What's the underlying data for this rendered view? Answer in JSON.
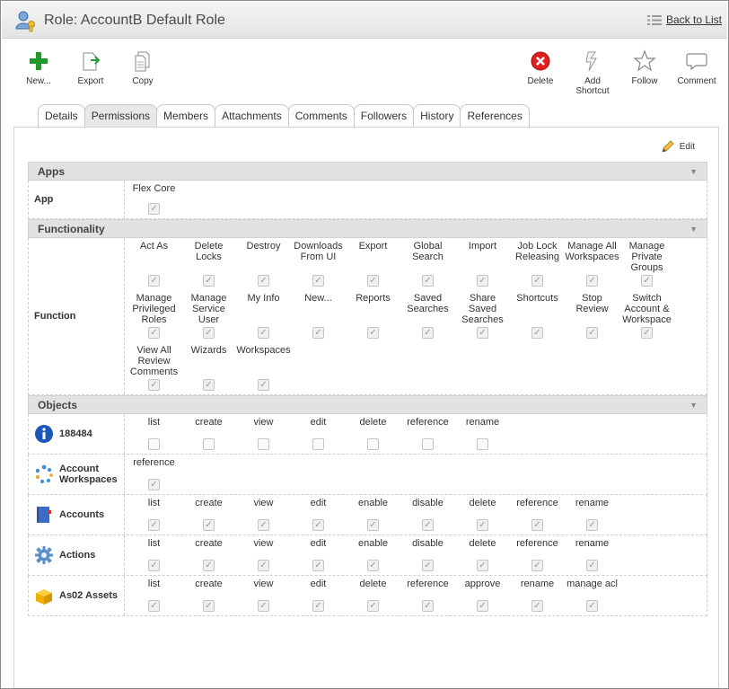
{
  "window": {
    "title": "Role: AccountB Default Role",
    "back_link": "Back to List"
  },
  "toolbar": {
    "new_label": "New...",
    "export_label": "Export",
    "copy_label": "Copy",
    "delete_label": "Delete",
    "add_shortcut_label": "Add Shortcut",
    "follow_label": "Follow",
    "comment_label": "Comment"
  },
  "tabs": [
    {
      "label": "Details",
      "active": false
    },
    {
      "label": "Permissions",
      "active": true
    },
    {
      "label": "Members",
      "active": false
    },
    {
      "label": "Attachments",
      "active": false
    },
    {
      "label": "Comments",
      "active": false
    },
    {
      "label": "Followers",
      "active": false
    },
    {
      "label": "History",
      "active": false
    },
    {
      "label": "References",
      "active": false
    }
  ],
  "edit_label": "Edit",
  "sections": [
    {
      "title": "Apps",
      "rows": [
        {
          "label": "App",
          "icon": "",
          "perms": [
            {
              "label": "Flex Core",
              "checked": true
            }
          ]
        }
      ]
    },
    {
      "title": "Functionality",
      "rows": [
        {
          "label": "Function",
          "icon": "",
          "perms": [
            {
              "label": "Act As",
              "checked": true
            },
            {
              "label": "Delete Locks",
              "checked": true
            },
            {
              "label": "Destroy",
              "checked": true
            },
            {
              "label": "Downloads From UI",
              "checked": true
            },
            {
              "label": "Export",
              "checked": true
            },
            {
              "label": "Global Search",
              "checked": true
            },
            {
              "label": "Import",
              "checked": true
            },
            {
              "label": "Job Lock Releasing",
              "checked": true
            },
            {
              "label": "Manage All Workspaces",
              "checked": true
            },
            {
              "label": "Manage Private Groups",
              "checked": true
            },
            {
              "label": "Manage Privileged Roles",
              "checked": true
            },
            {
              "label": "Manage Service User",
              "checked": true
            },
            {
              "label": "My Info",
              "checked": true
            },
            {
              "label": "New...",
              "checked": true
            },
            {
              "label": "Reports",
              "checked": true
            },
            {
              "label": "Saved Searches",
              "checked": true
            },
            {
              "label": "Share Saved Searches",
              "checked": true
            },
            {
              "label": "Shortcuts",
              "checked": true
            },
            {
              "label": "Stop Review",
              "checked": true
            },
            {
              "label": "Switch Account & Workspace",
              "checked": true
            },
            {
              "label": "View All Review Comments",
              "checked": true
            },
            {
              "label": "Wizards",
              "checked": true
            },
            {
              "label": "Workspaces",
              "checked": true
            }
          ]
        }
      ]
    },
    {
      "title": "Objects",
      "rows": [
        {
          "label": "188484",
          "icon": "info-icon",
          "perms": [
            {
              "label": "list",
              "checked": false
            },
            {
              "label": "create",
              "checked": false
            },
            {
              "label": "view",
              "checked": false
            },
            {
              "label": "edit",
              "checked": false
            },
            {
              "label": "delete",
              "checked": false
            },
            {
              "label": "reference",
              "checked": false
            },
            {
              "label": "rename",
              "checked": false
            }
          ]
        },
        {
          "label": "Account Workspaces",
          "icon": "workspaces-icon",
          "perms": [
            {
              "label": "reference",
              "checked": true
            }
          ]
        },
        {
          "label": "Accounts",
          "icon": "book-icon",
          "perms": [
            {
              "label": "list",
              "checked": true
            },
            {
              "label": "create",
              "checked": true
            },
            {
              "label": "view",
              "checked": true
            },
            {
              "label": "edit",
              "checked": true
            },
            {
              "label": "enable",
              "checked": true
            },
            {
              "label": "disable",
              "checked": true
            },
            {
              "label": "delete",
              "checked": true
            },
            {
              "label": "reference",
              "checked": true
            },
            {
              "label": "rename",
              "checked": true
            }
          ]
        },
        {
          "label": "Actions",
          "icon": "gear-icon",
          "perms": [
            {
              "label": "list",
              "checked": true
            },
            {
              "label": "create",
              "checked": true
            },
            {
              "label": "view",
              "checked": true
            },
            {
              "label": "edit",
              "checked": true
            },
            {
              "label": "enable",
              "checked": true
            },
            {
              "label": "disable",
              "checked": true
            },
            {
              "label": "delete",
              "checked": true
            },
            {
              "label": "reference",
              "checked": true
            },
            {
              "label": "rename",
              "checked": true
            }
          ]
        },
        {
          "label": "As02 Assets",
          "icon": "cube-icon",
          "perms": [
            {
              "label": "list",
              "checked": true
            },
            {
              "label": "create",
              "checked": true
            },
            {
              "label": "view",
              "checked": true
            },
            {
              "label": "edit",
              "checked": true
            },
            {
              "label": "delete",
              "checked": true
            },
            {
              "label": "reference",
              "checked": true
            },
            {
              "label": "approve",
              "checked": true
            },
            {
              "label": "rename",
              "checked": true
            },
            {
              "label": "manage acl",
              "checked": true
            }
          ]
        }
      ]
    }
  ]
}
